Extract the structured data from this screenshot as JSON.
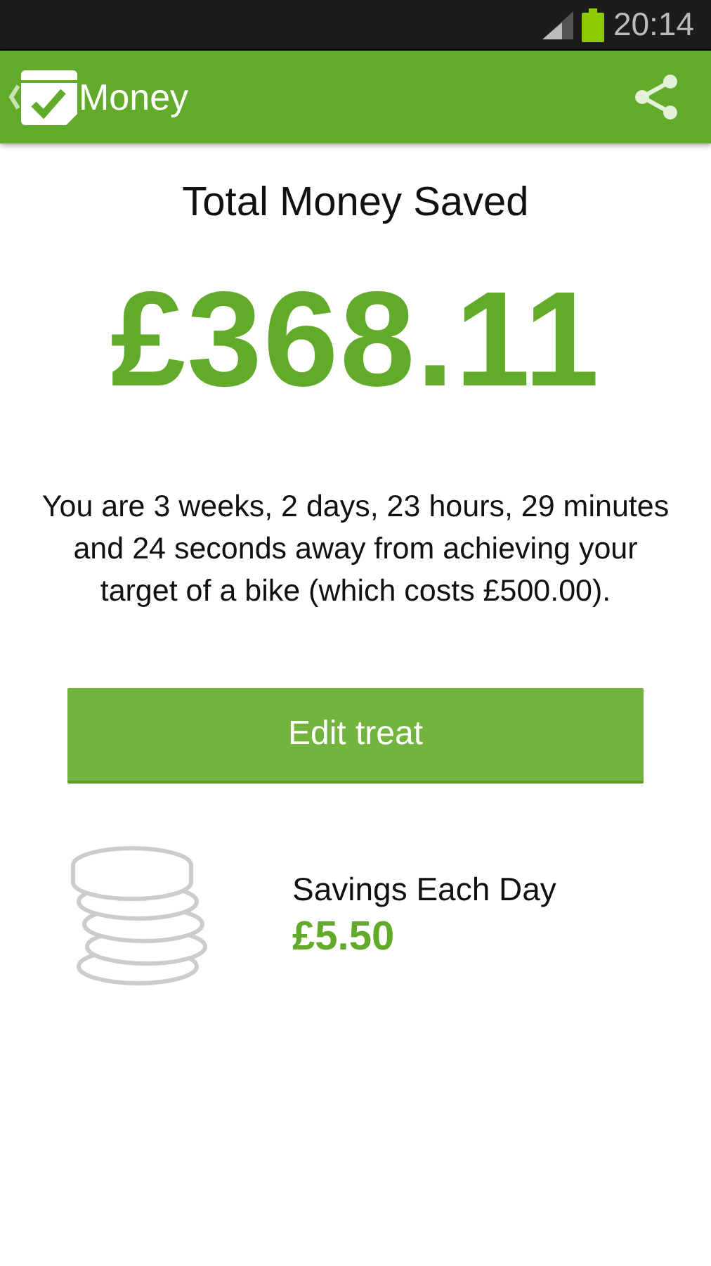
{
  "status_bar": {
    "time": "20:14"
  },
  "app_bar": {
    "title": "Money"
  },
  "total": {
    "label": "Total Money Saved",
    "amount": "£368.11"
  },
  "message": "You are 3 weeks, 2 days, 23 hours, 29 minutes and 24 seconds away from achieving your target of a bike (which costs £500.00).",
  "edit_button": {
    "label": "Edit treat"
  },
  "daily": {
    "label": "Savings Each Day",
    "amount": "£5.50"
  }
}
